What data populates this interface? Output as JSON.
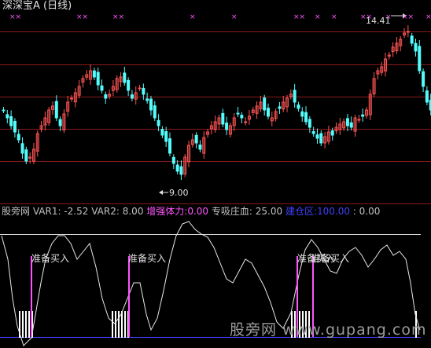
{
  "top_panel": {
    "title": "深深宝A (日线)",
    "high_label": "14.41",
    "low_label": "9.00",
    "x_markers": [
      "××",
      "××",
      "××",
      "×",
      "×",
      "××",
      "×",
      "×",
      "××",
      "×",
      "××",
      "×"
    ]
  },
  "indicator_header": {
    "name": "股旁网",
    "var1_label": "VAR1:",
    "var1_value": "-2.52",
    "var2_label": "VAR2:",
    "var2_value": "8.00",
    "f3_label": "增强体力:",
    "f3_value": "0.00",
    "f4_label": "专吸庄血:",
    "f4_value": "25.00",
    "f5_label": "建仓区:",
    "f5_value": "100.00",
    "f6_value": ": 0.00"
  },
  "signals": [
    "准备买入",
    "准备买入",
    "准备买入",
    "准备买入"
  ],
  "watermark": "股旁网 www.gupang.com",
  "colors": {
    "up": "#ff5454",
    "down": "#54fcfc",
    "signal": "#ff54ff",
    "label": "#c0c0c0",
    "highlight": "#ff54ff",
    "blue": "#4040ff",
    "white": "#ffffff",
    "yellow": "#ffff54"
  },
  "chart_data": {
    "type": "candlestick",
    "price_high": 14.41,
    "price_low": 9.0,
    "signal_label": "准备买入",
    "indicator_series": "VAR1",
    "indicator_last": -2.52
  }
}
